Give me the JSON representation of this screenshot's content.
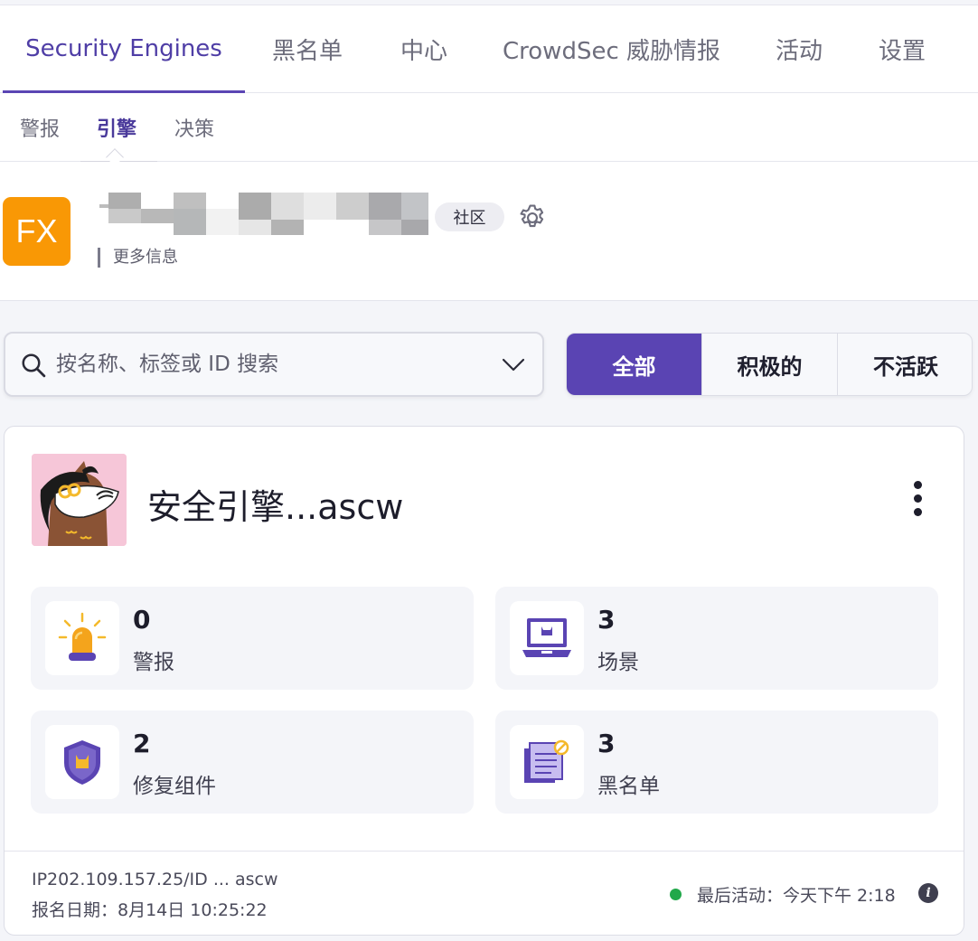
{
  "nav": {
    "tabs": [
      {
        "label": "Security Engines",
        "active": true
      },
      {
        "label": "黑名单"
      },
      {
        "label": "中心"
      },
      {
        "label": "CrowdSec 威胁情报"
      },
      {
        "label": "活动"
      },
      {
        "label": "设置"
      }
    ],
    "subtabs": [
      {
        "label": "警报"
      },
      {
        "label": "引擎",
        "active": true
      },
      {
        "label": "决策"
      }
    ]
  },
  "org": {
    "avatar_initials": "FX",
    "avatar_color": "#f99805",
    "badge": "社区",
    "more_info": "更多信息"
  },
  "search": {
    "placeholder": "按名称、标签或 ID 搜索"
  },
  "filter": {
    "options": [
      "全部",
      "积极的",
      "不活跃"
    ],
    "selected": "全部",
    "accent": "#5a44b3"
  },
  "engine": {
    "name": "安全引擎...ascw",
    "stats": [
      {
        "value": "0",
        "label": "警报",
        "icon": "alert-siren-icon"
      },
      {
        "value": "3",
        "label": "场景",
        "icon": "scenario-laptop-icon"
      },
      {
        "value": "2",
        "label": "修复组件",
        "icon": "remediation-shield-icon"
      },
      {
        "value": "3",
        "label": "黑名单",
        "icon": "blocklist-document-icon"
      }
    ],
    "footer": {
      "ip_id": "IP202.109.157.25/ID ... ascw",
      "enrolled": "报名日期：8月14日 10:25:22",
      "last_active": "最后活动：今天下午 2:18",
      "status_color": "#21a84a"
    }
  }
}
